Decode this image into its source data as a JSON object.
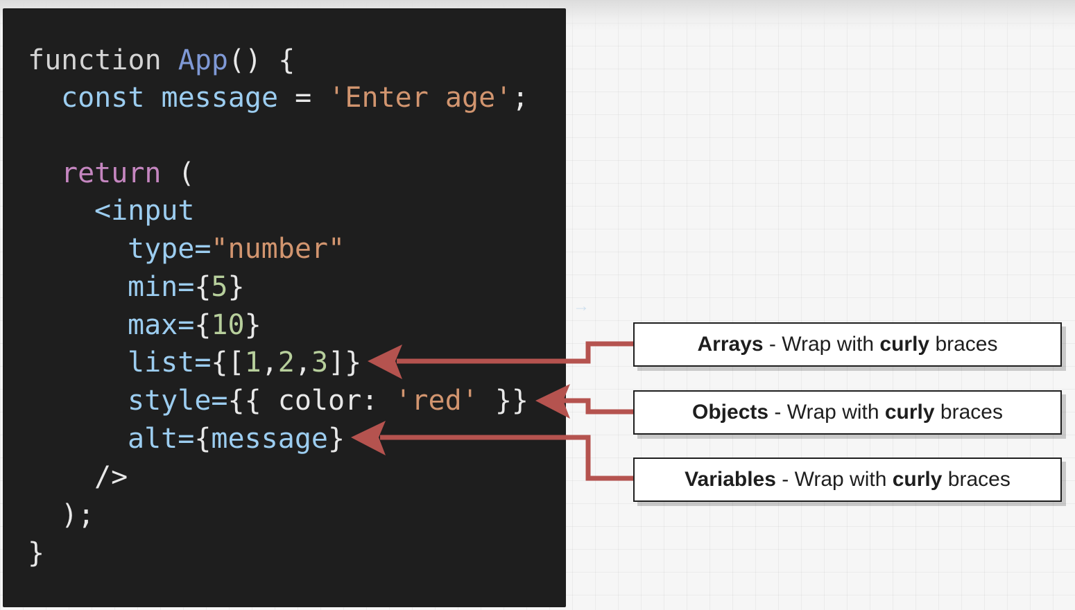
{
  "code": {
    "line1": {
      "kw": "function",
      "fn": "App",
      "rest": "() {"
    },
    "line2": {
      "kw": "const",
      "var": "message",
      "eq": " = ",
      "str": "'Enter age'",
      "semi": ";"
    },
    "line4": {
      "kw": "return",
      "rest": " ("
    },
    "line5": {
      "text": "<input"
    },
    "line6": {
      "attr": "type=",
      "str": "\"number\""
    },
    "line7": {
      "attr": "min=",
      "open": "{",
      "num": "5",
      "close": "}"
    },
    "line8": {
      "attr": "max=",
      "open": "{",
      "num": "10",
      "close": "}"
    },
    "line9": {
      "attr": "list=",
      "open": "{[",
      "n1": "1",
      "c1": ",",
      "n2": "2",
      "c2": ",",
      "n3": "3",
      "close": "]}"
    },
    "line10": {
      "attr": "style=",
      "open": "{{ ",
      "key": "color",
      "colon": ": ",
      "str": "'red'",
      "close": " }}"
    },
    "line11": {
      "attr": "alt=",
      "open": "{",
      "var": "message",
      "close": "}"
    },
    "line12": {
      "text": "/>"
    },
    "line13": {
      "text": ");"
    },
    "line14": {
      "text": "}"
    }
  },
  "labels": {
    "arrays": {
      "bold": "Arrays",
      "mid": " - Wrap with ",
      "bold2": "curly",
      "end": " braces"
    },
    "objects": {
      "bold": "Objects",
      "mid": " - Wrap with ",
      "bold2": "curly",
      "end": " braces"
    },
    "variables": {
      "bold": "Variables",
      "mid": " - Wrap with ",
      "bold2": "curly",
      "end": " braces"
    }
  },
  "colors": {
    "arrow": "#b5534f",
    "code_background": "#1e1e1e",
    "string": "#d2956f",
    "number": "#b7cf9c",
    "keyword_return": "#c586c0",
    "identifier": "#9ccdf0",
    "function_name": "#7f99d6"
  }
}
